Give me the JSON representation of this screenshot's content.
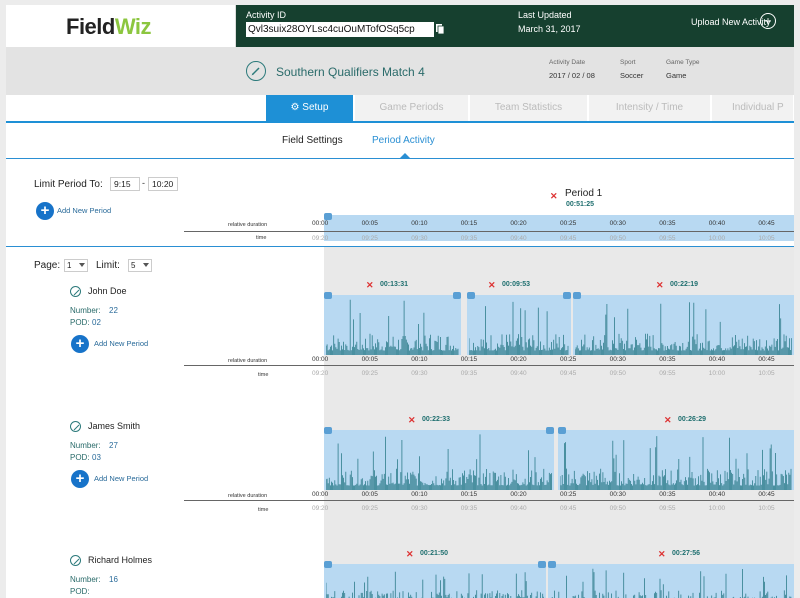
{
  "header": {
    "logo_a": "Field",
    "logo_b": "Wiz",
    "activity_id_label": "Activity ID",
    "activity_id_value": "Qvl3suix28OYLsc4cuOuMTofOSq5cp",
    "last_updated_label": "Last Updated",
    "last_updated_value": "March 31, 2017",
    "upload_label": "Upload New Activity"
  },
  "activity": {
    "title": "Southern Qualifiers Match 4",
    "date_label": "Activity Date",
    "date_value": "2017 / 02 / 08",
    "sport_label": "Sport",
    "sport_value": "Soccer",
    "game_type_label": "Game Type",
    "game_type_value": "Game"
  },
  "tabs": [
    {
      "label": "Setup",
      "icon": "gear-icon",
      "active": true
    },
    {
      "label": "Game Periods"
    },
    {
      "label": "Team Statistics"
    },
    {
      "label": "Intensity / Time"
    },
    {
      "label": "Individual P"
    }
  ],
  "subtabs": [
    {
      "label": "Field Settings",
      "active": false
    },
    {
      "label": "Period Activity",
      "active": true
    }
  ],
  "limit": {
    "label": "Limit Period To:",
    "from": "9:15",
    "sep": "-",
    "to": "10:20",
    "add_label": "Add New Period"
  },
  "period": {
    "name": "Period 1",
    "duration": "00:51:25"
  },
  "axis": {
    "relative_label": "relative duration",
    "time_label": "time",
    "relative_ticks": [
      "00:00",
      "00:05",
      "00:10",
      "00:15",
      "00:20",
      "00:25",
      "00:30",
      "00:35",
      "00:40",
      "00:45"
    ],
    "time_ticks": [
      "09:20",
      "09:25",
      "09:30",
      "09:35",
      "09:40",
      "09:45",
      "09:50",
      "09:55",
      "10:00",
      "10:05"
    ]
  },
  "pagination": {
    "page_label": "Page:",
    "page_value": "1",
    "limit_label": "Limit:",
    "limit_value": "5"
  },
  "players": [
    {
      "name": "John Doe",
      "number_label": "Number:",
      "number": "22",
      "pod_label": "POD:",
      "pod": "02",
      "add_label": "Add New Period",
      "segments": [
        "00:13:31",
        "00:09:53",
        "00:22:19"
      ]
    },
    {
      "name": "James Smith",
      "number_label": "Number:",
      "number": "27",
      "pod_label": "POD:",
      "pod": "03",
      "add_label": "Add New Period",
      "segments": [
        "00:22:33",
        "00:26:29"
      ]
    },
    {
      "name": "Richard Holmes",
      "number_label": "Number:",
      "number": "16",
      "pod_label": "POD:",
      "pod": "",
      "segments": [
        "00:21:50",
        "00:27:56"
      ]
    }
  ],
  "colors": {
    "header_dark": "#16402f",
    "accent_blue": "#1e90d6",
    "band_blue": "#b8d9f2",
    "bar_teal": "#2f7d8c",
    "logo_green": "#8cc63f"
  }
}
